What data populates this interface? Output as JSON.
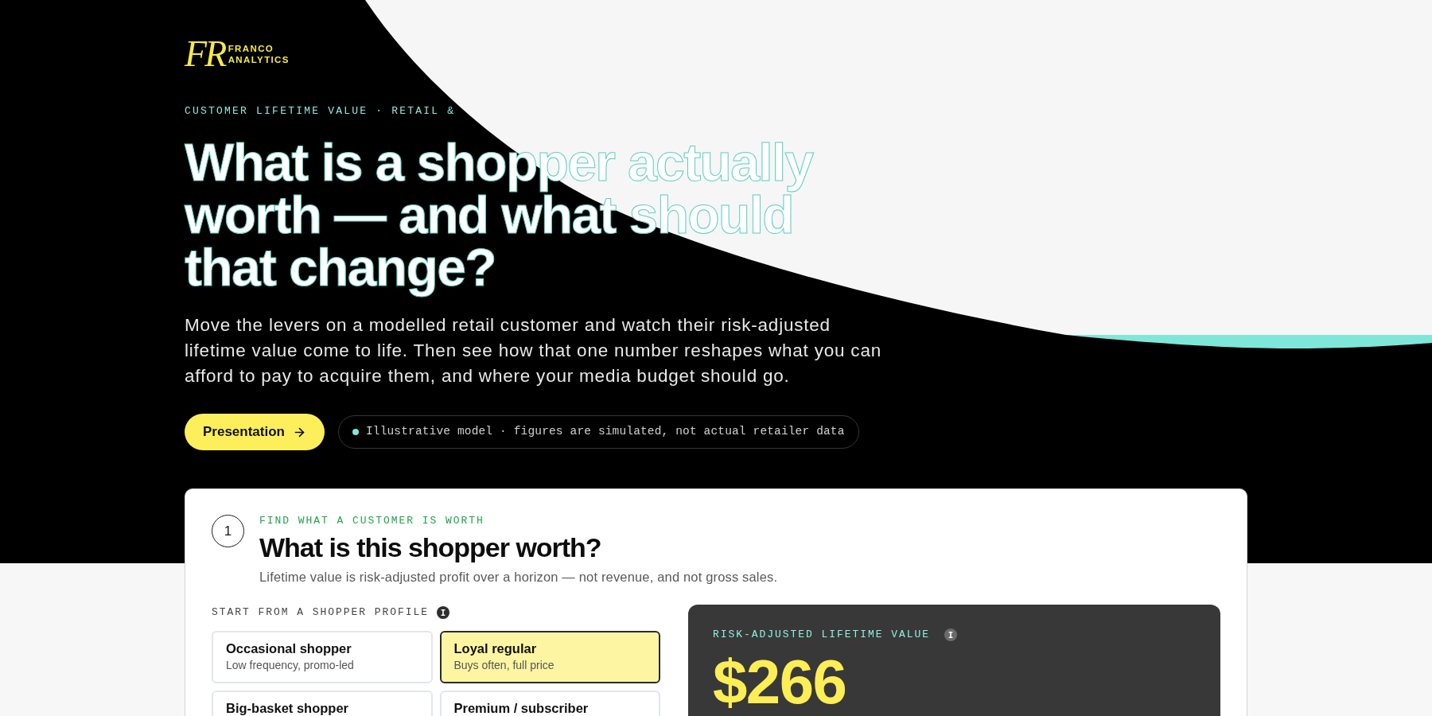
{
  "logo": {
    "monogram": "FR",
    "name": "FRANCO ANALYTICS"
  },
  "hero": {
    "eyebrow": "CUSTOMER LIFETIME VALUE · RETAIL &",
    "title": "What is a shopper actually worth — and what should that change?",
    "intro": "Move the levers on a modelled retail customer and watch their risk-adjusted lifetime value come to life. Then see how that one number reshapes what you can afford to pay to acquire them, and where your media budget should go.",
    "cta": {
      "label": "Presentation"
    },
    "disclaimer": "Illustrative model · figures are simulated, not actual retailer data"
  },
  "section": {
    "step": "1",
    "eyebrow": "FIND WHAT A CUSTOMER IS WORTH",
    "title": "What is this shopper worth?",
    "subtitle": "Lifetime value is risk-adjusted profit over a horizon — not revenue, and not gross sales.",
    "profile_label": "START FROM A SHOPPER PROFILE",
    "profiles": [
      {
        "name": "Occasional shopper",
        "description": "Low frequency, promo-led",
        "selected": false
      },
      {
        "name": "Loyal regular",
        "description": "Buys often, full price",
        "selected": true
      },
      {
        "name": "Big-basket shopper",
        "selected": false
      },
      {
        "name": "Premium / subscriber",
        "selected": false
      }
    ],
    "value_panel": {
      "label": "RISK-ADJUSTED LIFETIME VALUE",
      "value": "$266"
    }
  }
}
